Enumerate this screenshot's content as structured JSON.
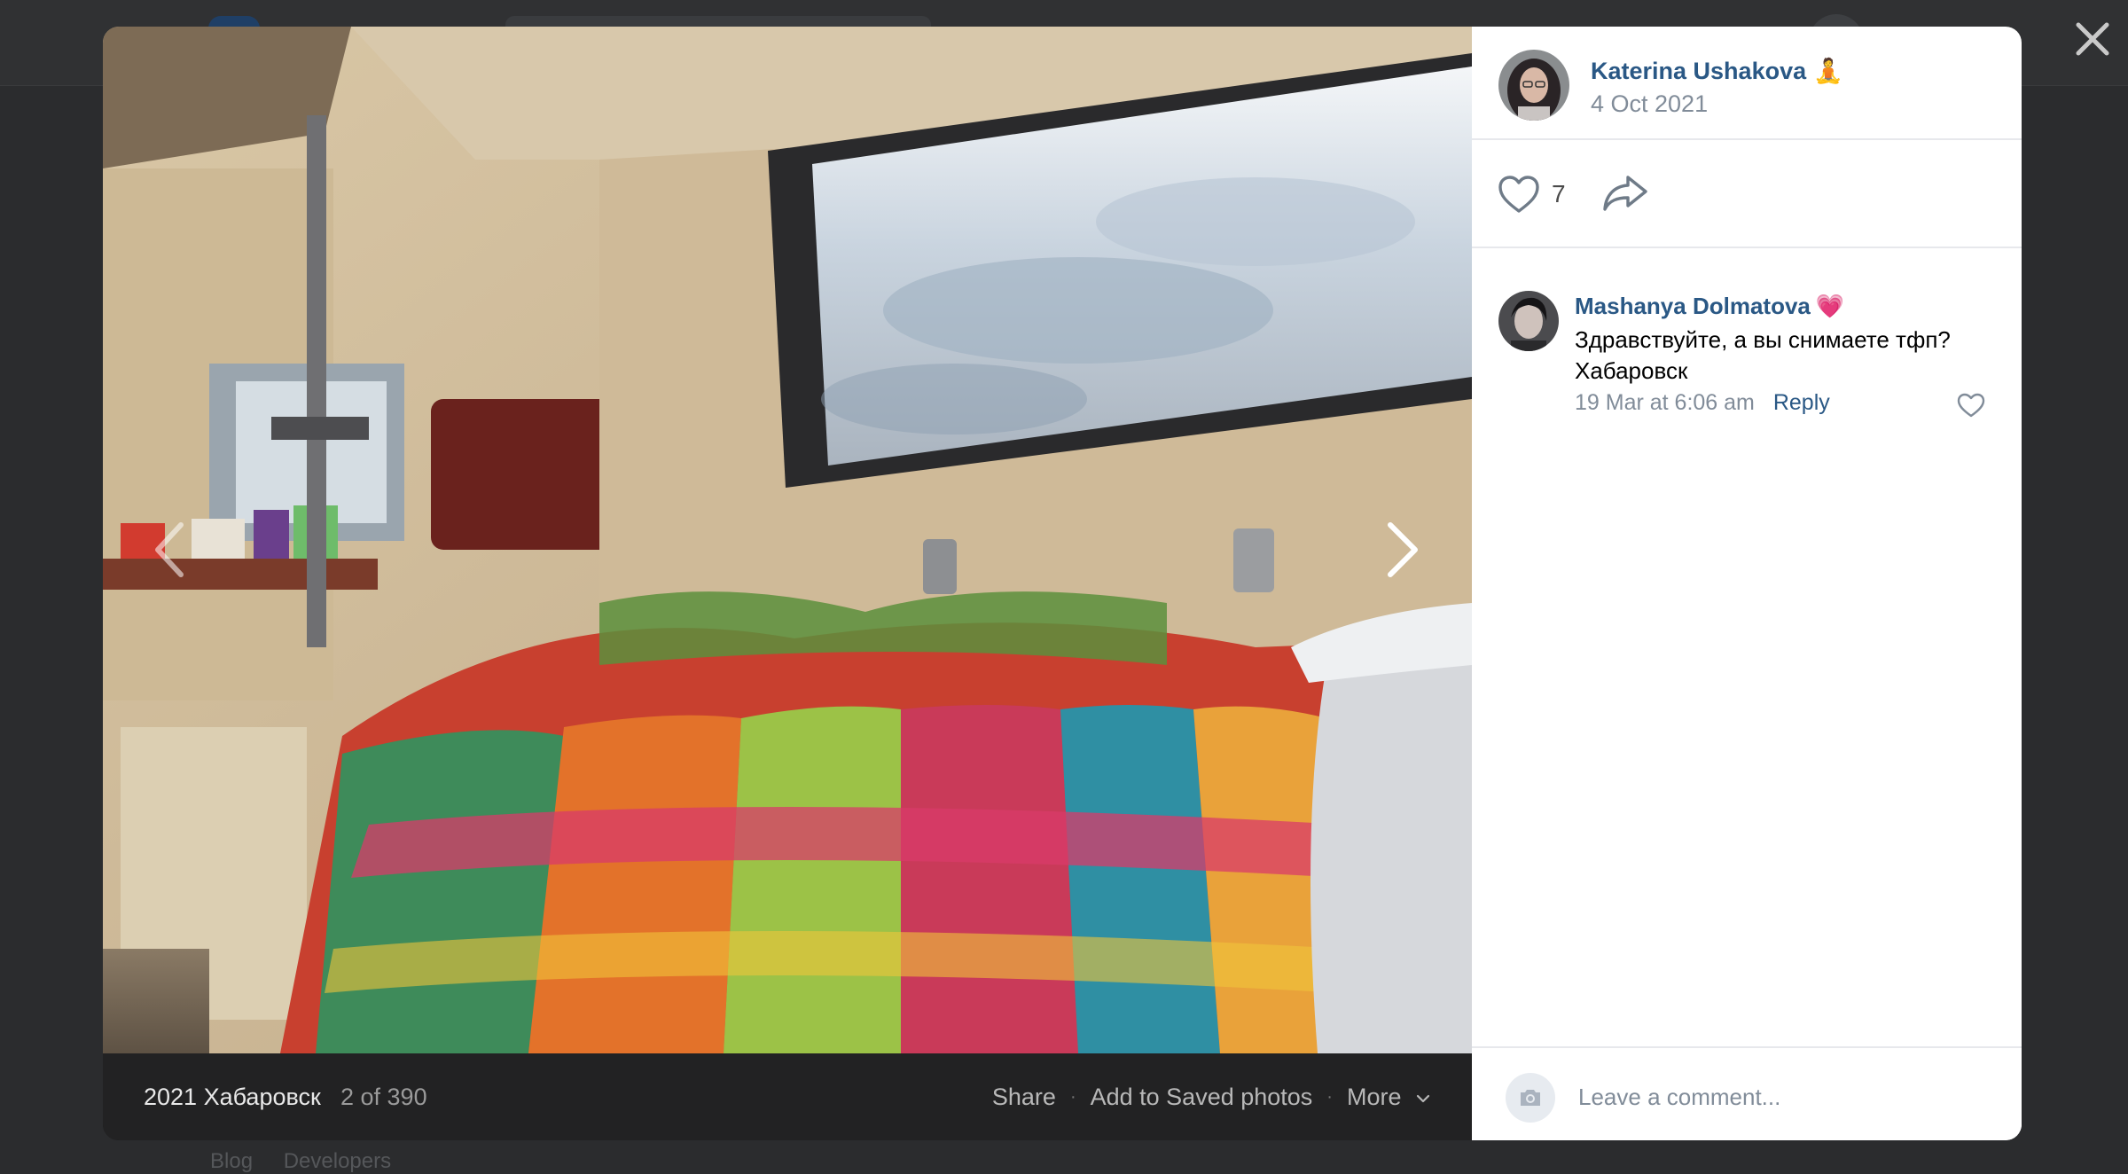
{
  "background": {
    "footer_links": [
      "Blog",
      "Developers"
    ]
  },
  "viewer": {
    "close_icon": "close-icon",
    "album_title": "2021 Хабаровск",
    "counter": "2 of 390",
    "actions": {
      "share": "Share",
      "save": "Add to Saved photos",
      "more": "More"
    }
  },
  "post": {
    "author": "Katerina Ushakova",
    "author_emoji": "🧘",
    "date": "4 Oct 2021",
    "likes": "7"
  },
  "comments": [
    {
      "author": "Mashanya Dolmatova",
      "author_emoji": "💗",
      "text": "Здравствуйте, а вы снимаете тфп? Хабаровск",
      "time": "19 Mar at 6:06 am",
      "reply_label": "Reply"
    }
  ],
  "comment_input": {
    "placeholder": "Leave a comment..."
  },
  "colors": {
    "link": "#2a5885",
    "muted": "#818c99",
    "viewer_bar": "#222223",
    "overlay": "#2b2c2e"
  }
}
